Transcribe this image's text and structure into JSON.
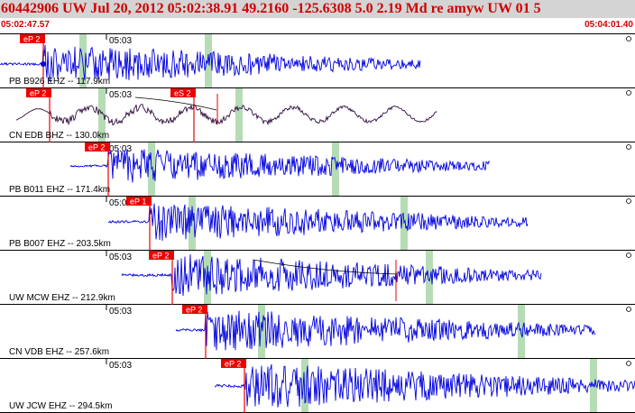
{
  "header": {
    "title": "60442906 UW Jul 20, 2012 05:02:38.91    49.2160 -125.6308   5.0 2.19 Md re amyw UW 01   5",
    "time_start": "05:02:47.57",
    "time_end": "05:04:01.40"
  },
  "colors": {
    "trace": "#0000e0",
    "trace_alt": "#301040",
    "pick": "#ee0000",
    "highlight": "#b6dcb6",
    "background": "#ffffff",
    "header_bg": "#d4d4d4"
  },
  "tick_label": "05:03",
  "stations": [
    {
      "label": "PB B926 EHZ -- 117.9km",
      "pick": "eP 2",
      "color": "#0000e0"
    },
    {
      "label": "CN EDB BHZ -- 130.0km",
      "pick": "eP 2",
      "extra_pick": "eS 2",
      "color": "#301040"
    },
    {
      "label": "PB B011 EHZ -- 171.4km",
      "pick": "eP 2",
      "color": "#0000e0"
    },
    {
      "label": "PB B007 EHZ -- 203.5km",
      "pick": "eP 1",
      "color": "#0000e0"
    },
    {
      "label": "UW MCW EHZ -- 212.9km",
      "pick": "eP 2",
      "color": "#0000e0"
    },
    {
      "label": "CN VDB EHZ -- 257.6km",
      "pick": "eP 2",
      "color": "#0000e0"
    },
    {
      "label": "UW JCW EHZ -- 294.5km",
      "pick": "eP 2",
      "color": "#0000e0"
    }
  ]
}
